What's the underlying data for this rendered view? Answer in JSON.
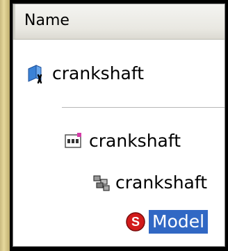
{
  "column_header": "Name",
  "tree": {
    "root_label": "crankshaft",
    "child_label": "crankshaft",
    "grandchild_label": "crankshaft",
    "leaf_label": "Model"
  },
  "icons": {
    "root": "part-folder-icon",
    "child": "ddb-document-icon",
    "grandchild": "assembly-cubes-icon",
    "leaf": "red-s-model-icon"
  },
  "colors": {
    "selection": "#3168c4",
    "leaf_icon": "#d21b1b"
  }
}
